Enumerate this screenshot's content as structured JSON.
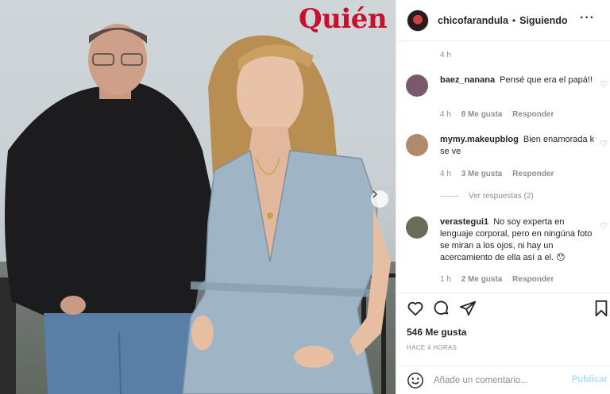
{
  "photo": {
    "magazine_logo": "Quién",
    "carousel_icon": "chevron-right-icon"
  },
  "post": {
    "username": "chicofarandula",
    "separator": "•",
    "follow_status": "Siguiendo",
    "more": "···",
    "caption_time": "4 h"
  },
  "comments": [
    {
      "username": "baez_nanana",
      "text": "Pensé que era el papá!!",
      "time": "4 h",
      "likes": "8 Me gusta",
      "reply": "Responder",
      "avatar_color": "#7a5a6a"
    },
    {
      "username": "mymy.makeupblog",
      "text": "Bien enamorada k se ve",
      "time": "4 h",
      "likes": "3 Me gusta",
      "reply": "Responder",
      "avatar_color": "#b08a6a"
    },
    {
      "username": "verastegui1",
      "text": "No soy experta en lenguaje corporal, pero en ningúna foto se miran a los ojos, ni hay un acercamiento de ella así a el. 😯",
      "time": "1 h",
      "likes": "2 Me gusta",
      "reply": "Responder",
      "avatar_color": "#6b6b5a"
    }
  ],
  "view_replies": "Ver respuestas (2)",
  "likes_count": "546 Me gusta",
  "posted_ago": "HACE 4 HORAS",
  "add_comment": {
    "placeholder": "Añade un comentario...",
    "publish": "Publicar"
  },
  "colors": {
    "brand_logo": "#c8102e",
    "publish_disabled": "#b2dffc",
    "muted_text": "#8e8e8e"
  }
}
